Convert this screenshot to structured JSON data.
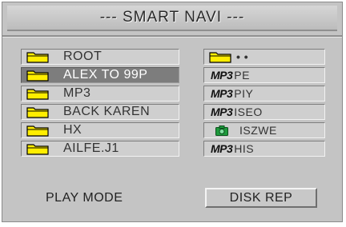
{
  "header": {
    "title": "--- SMART NAVI ---"
  },
  "left_list": {
    "items": [
      {
        "label": "ROOT",
        "icon": "folder-icon",
        "selected": false
      },
      {
        "label": "ALEX TO 99P",
        "icon": "folder-icon",
        "selected": true
      },
      {
        "label": "MP3",
        "icon": "folder-icon",
        "selected": false
      },
      {
        "label": "BACK KAREN",
        "icon": "folder-icon",
        "selected": false
      },
      {
        "label": "HX",
        "icon": "folder-icon",
        "selected": false
      },
      {
        "label": "AILFE.J1",
        "icon": "folder-icon",
        "selected": false
      }
    ]
  },
  "right_list": {
    "items": [
      {
        "tag": "",
        "label": "• •",
        "icon": "folder-icon"
      },
      {
        "tag": "MP3",
        "label": "PE",
        "icon": "mp3-icon"
      },
      {
        "tag": "MP3",
        "label": "PIY",
        "icon": "mp3-icon"
      },
      {
        "tag": "MP3",
        "label": "ISEO",
        "icon": "mp3-icon"
      },
      {
        "tag": "",
        "label": "ISZWE",
        "icon": "photo-icon"
      },
      {
        "tag": "MP3",
        "label": "HIS",
        "icon": "mp3-icon"
      }
    ]
  },
  "footer": {
    "play_mode_label": "PLAY MODE",
    "disk_rep_label": "DISK REP"
  },
  "colors": {
    "panel_bg": "#c4c4c4",
    "selected_bg": "#7d7d7d",
    "folder_yellow": "#ffee00",
    "photo_green": "#1e9a3c"
  }
}
